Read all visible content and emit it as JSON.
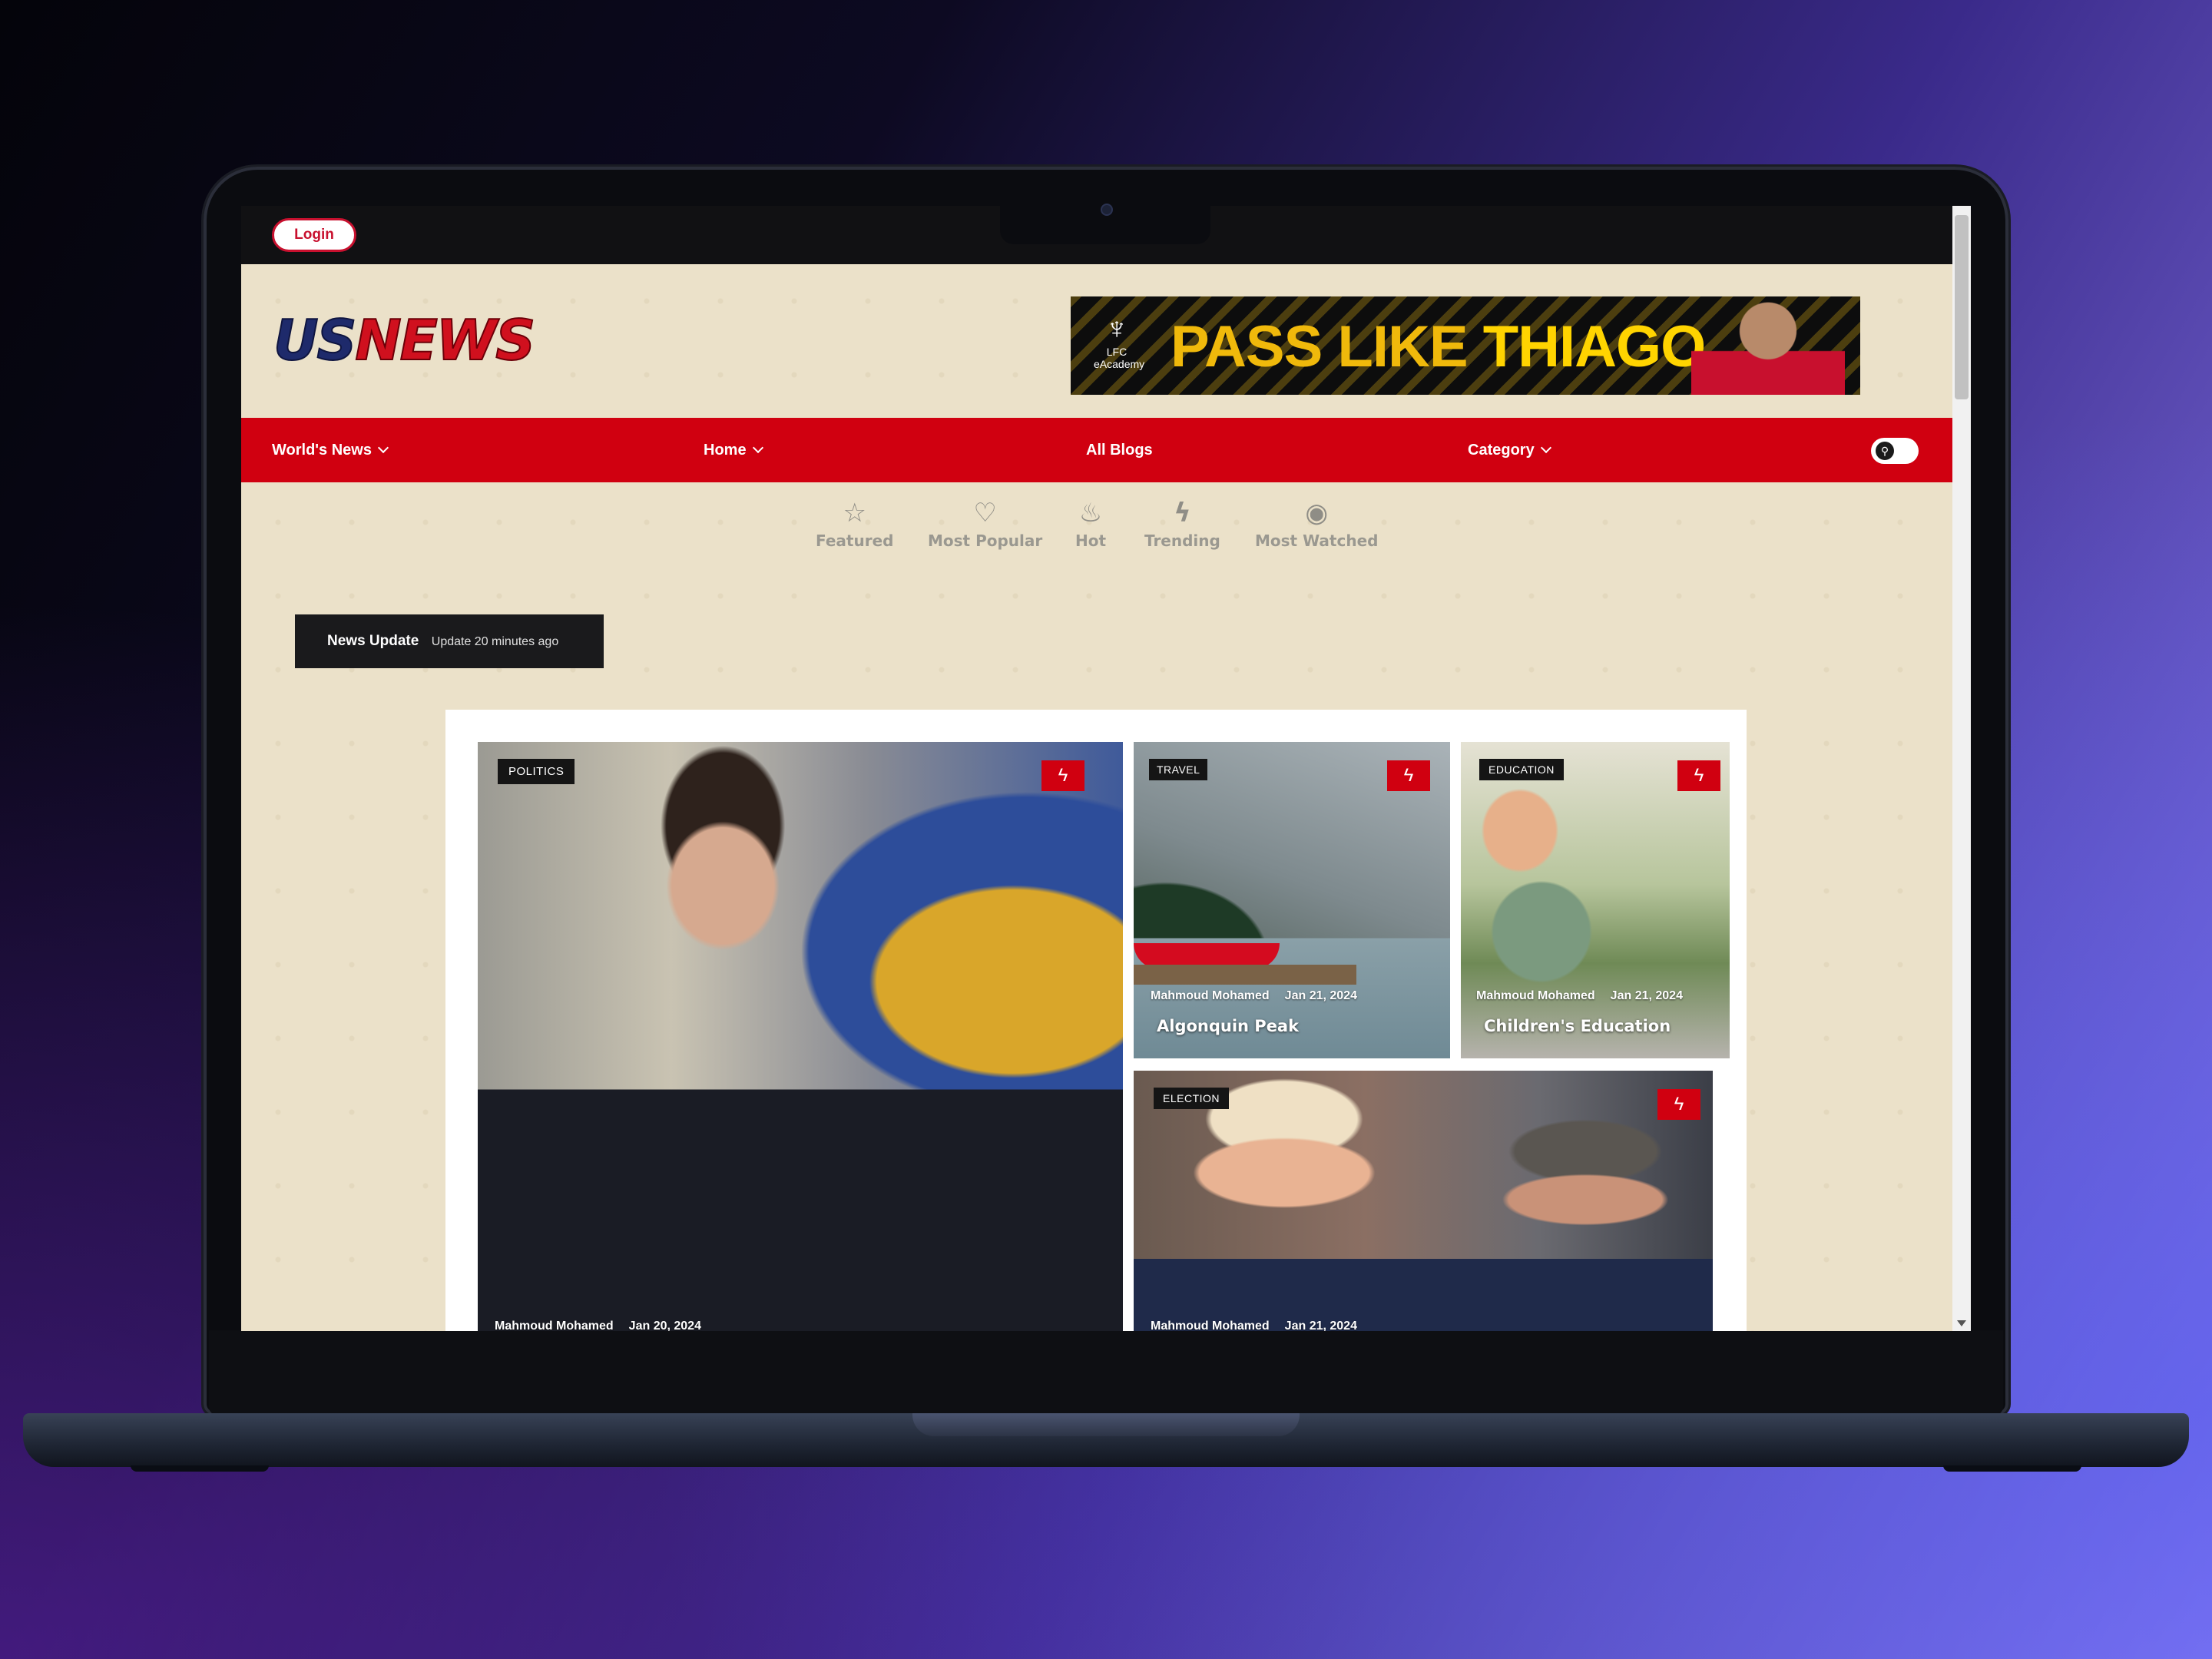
{
  "topbar": {
    "login_label": "Login"
  },
  "header": {
    "logo_part1": "US",
    "logo_part2": "NEWS",
    "ad": {
      "crest_line1": "LFC",
      "crest_line2": "eAcademy",
      "text_part1": "PASS LIKE",
      "text_part2": "THIAGO"
    }
  },
  "nav": {
    "items": [
      {
        "label": "World's News",
        "has_dropdown": true
      },
      {
        "label": "Home",
        "has_dropdown": true
      },
      {
        "label": "All Blogs",
        "has_dropdown": false
      },
      {
        "label": "Category",
        "has_dropdown": true
      }
    ],
    "search_icon": "search-icon",
    "accent_color": "#d00010"
  },
  "filters": [
    {
      "label": "Featured",
      "icon": "star-icon"
    },
    {
      "label": "Most Popular",
      "icon": "heart-icon"
    },
    {
      "label": "Hot",
      "icon": "fire-icon"
    },
    {
      "label": "Trending",
      "icon": "bolt-icon"
    },
    {
      "label": "Most Watched",
      "icon": "eye-icon"
    }
  ],
  "news_update": {
    "title": "News Update",
    "subtitle": "Update 20 minutes ago"
  },
  "cards": [
    {
      "tag": "POLITICS",
      "author": "Mahmoud Mohamed",
      "date": "Jan 20, 2024",
      "title": ""
    },
    {
      "tag": "TRAVEL",
      "author": "Mahmoud Mohamed",
      "date": "Jan 21, 2024",
      "title": "Algonquin Peak"
    },
    {
      "tag": "EDUCATION",
      "author": "Mahmoud Mohamed",
      "date": "Jan 21, 2024",
      "title": "Children's Education"
    },
    {
      "tag": "ELECTION",
      "author": "Mahmoud Mohamed",
      "date": "Jan 21, 2024",
      "title": ""
    }
  ]
}
